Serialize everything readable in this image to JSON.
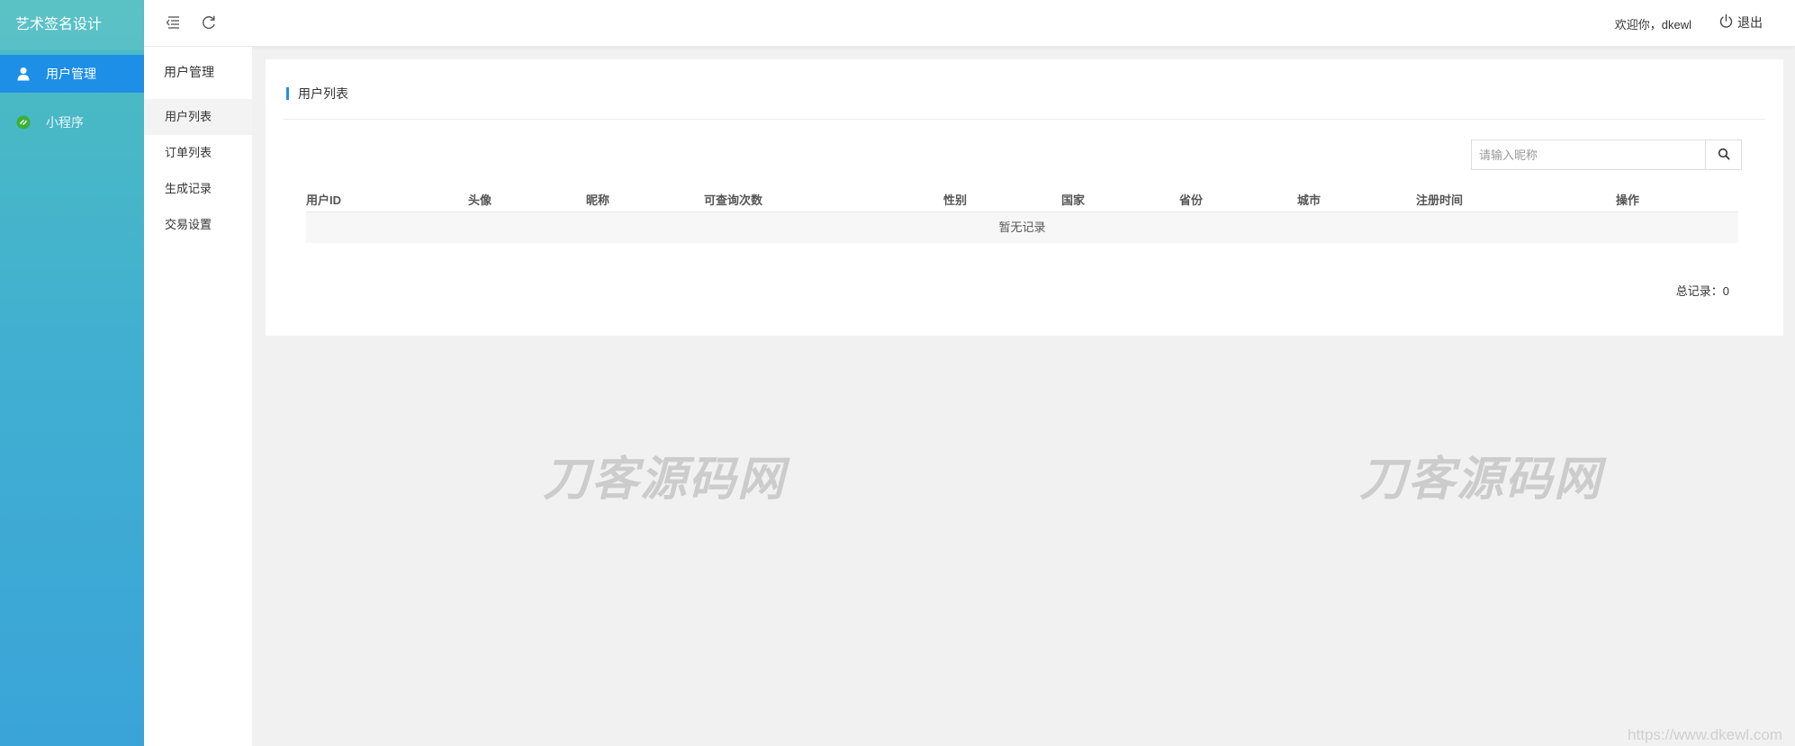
{
  "app": {
    "brand": "艺术签名设计"
  },
  "sidebar": {
    "items": [
      {
        "label": "用户管理",
        "icon": "user-icon",
        "active": true
      },
      {
        "label": "小程序",
        "icon": "mini-program-icon",
        "active": false
      }
    ]
  },
  "submenu": {
    "title": "用户管理",
    "items": [
      {
        "label": "用户列表",
        "active": true
      },
      {
        "label": "订单列表"
      },
      {
        "label": "生成记录"
      },
      {
        "label": "交易设置"
      }
    ]
  },
  "header": {
    "welcome": "欢迎你，dkewl",
    "logout_label": "退出",
    "icons": [
      "collapse-menu-icon",
      "refresh-icon",
      "power-icon"
    ]
  },
  "card": {
    "title": "用户列表",
    "search": {
      "placeholder": "请输入昵称",
      "value": ""
    },
    "table": {
      "columns": [
        "用户ID",
        "头像",
        "昵称",
        "可查询次数",
        "性别",
        "国家",
        "省份",
        "城市",
        "注册时间",
        "操作"
      ],
      "rows": [],
      "empty_text": "暂无记录"
    },
    "total": "总记录：0"
  },
  "watermark": {
    "text": "刀客源码网",
    "url": "https://www.dkewl.com"
  },
  "colors": {
    "accent": "#1e8fe6",
    "sidebar_top": "#4dbdc1",
    "sidebar_bottom": "#3aa4d9",
    "mini_program_icon": "#3cb034"
  }
}
